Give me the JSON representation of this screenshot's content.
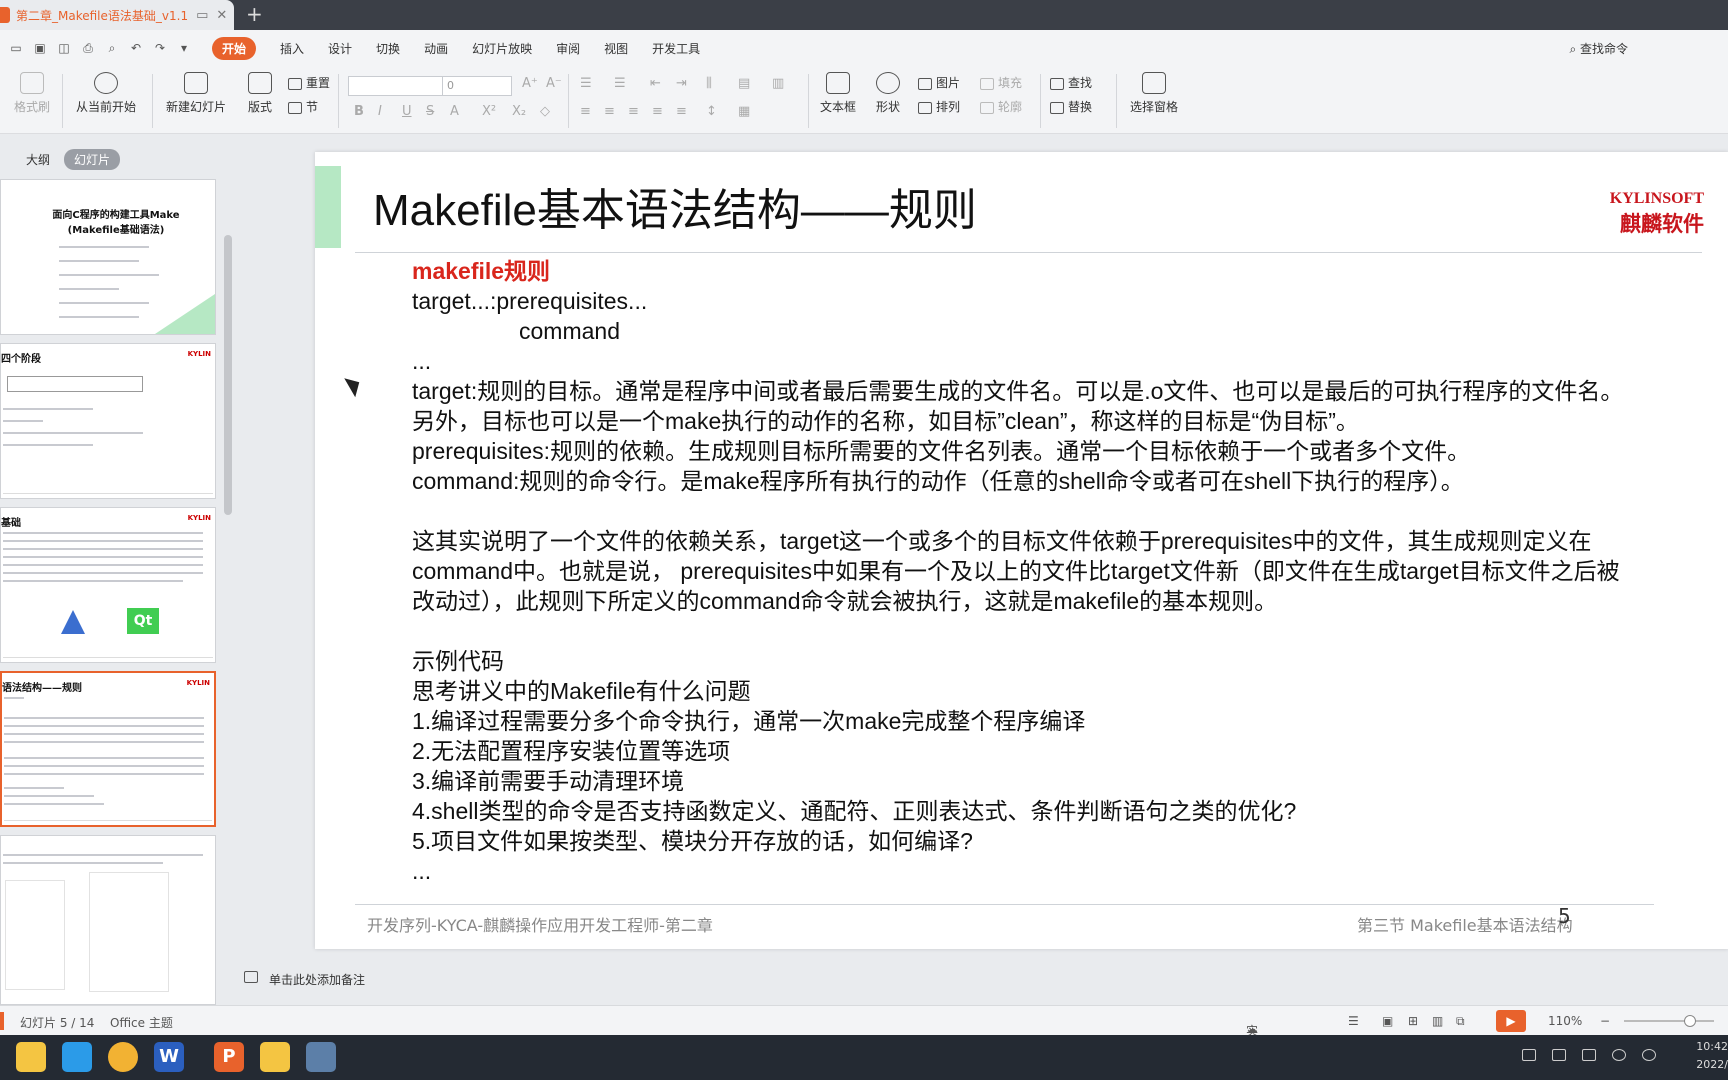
{
  "window": {
    "doc_title": "第二章_Makefile语法基础_v1.1",
    "new_tab": "+"
  },
  "menu": {
    "items": [
      "开始",
      "插入",
      "设计",
      "切换",
      "动画",
      "幻灯片放映",
      "审阅",
      "视图",
      "开发工具"
    ],
    "find_command": "查找命令"
  },
  "ribbon": {
    "format_painter": "格式刷",
    "play_from_current": "从当前开始",
    "new_slide": "新建幻灯片",
    "layout": "版式",
    "reset": "重置",
    "section": "节",
    "font_size": "0",
    "textbox": "文本框",
    "shape": "形状",
    "picture": "图片",
    "fill": "填充",
    "arrange": "排列",
    "outline": "轮廓",
    "find": "查找",
    "replace": "替换",
    "select_pane": "选择窗格",
    "format_glyphs": [
      "B",
      "I",
      "U",
      "S",
      "A",
      "X²",
      "X₂"
    ]
  },
  "left_panel": {
    "tab_outline": "大纲",
    "tab_slides": "幻灯片",
    "thumbnails": [
      {
        "title": "面向C程序的构建工具Make\n(Makefile基础语法)"
      },
      {
        "title": "四个阶段"
      },
      {
        "title": "基础"
      },
      {
        "title": "语法结构——规则"
      },
      {
        "title": ""
      }
    ]
  },
  "slide": {
    "title": "Makefile基本语法结构——规则",
    "logo_line1": "KYLINSOFT",
    "logo_line2": "麒麟软件",
    "heading": "makefile规则",
    "lines": [
      "target...:prerequisites...",
      "command",
      "...",
      "target:规则的目标。通常是程序中间或者最后需要生成的文件名。可以是.o文件、也可以是最后的可执行程序的文件名。另外，目标也可以是一个make执行的动作的名称，如目标”clean”，称这样的目标是“伪目标”。",
      "prerequisites:规则的依赖。生成规则目标所需要的文件名列表。通常一个目标依赖于一个或者多个文件。",
      "command:规则的命令行。是make程序所有执行的动作（任意的shell命令或者可在shell下执行的程序）。",
      "这其实说明了一个文件的依赖关系，target这一个或多个的目标文件依赖于prerequisites中的文件，其生成规则定义在command中。也就是说， prerequisites中如果有一个及以上的文件比target文件新（即文件在生成target目标文件之后被改动过），此规则下所定义的command命令就会被执行，这就是makefile的基本规则。",
      "示例代码",
      "思考讲义中的Makefile有什么问题",
      "1.编译过程需要分多个命令执行，通常一次make完成整个程序编译",
      "2.无法配置程序安装位置等选项",
      "3.编译前需要手动清理环境",
      "4.shell类型的命令是否支持函数定义、通配符、正则表达式、条件判断语句之类的优化?",
      "5.项目文件如果按类型、模块分开存放的话，如何编译?",
      "..."
    ],
    "footer_left": "开发序列-KYCA-麒麟操作应用开发工程师-第二章",
    "footer_right": "第三节 Makefile基本语法结构",
    "page_number": "5"
  },
  "notes": {
    "placeholder": "单击此处添加备注"
  },
  "status": {
    "slide_counter": "幻灯片 5 / 14",
    "theme": "Office 主题",
    "backup": "实时备份",
    "zoom": "110%"
  },
  "taskbar": {
    "time": "10:42",
    "date": "2022/"
  },
  "colors": {
    "accent": "#e8622c",
    "heading_red": "#d9261c",
    "accent_green": "#b6e8c4",
    "taskbar": "#242a33"
  }
}
